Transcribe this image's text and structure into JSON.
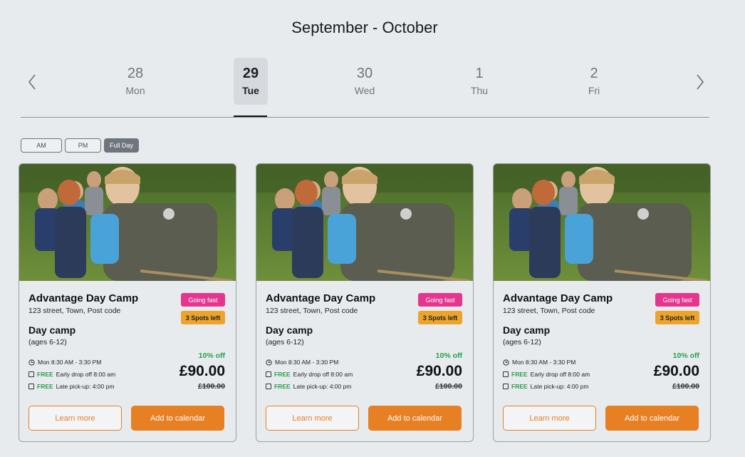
{
  "header": {
    "month_range": "September - October"
  },
  "dates": [
    {
      "num": "28",
      "day": "Mon"
    },
    {
      "num": "29",
      "day": "Tue"
    },
    {
      "num": "30",
      "day": "Wed"
    },
    {
      "num": "1",
      "day": "Thu"
    },
    {
      "num": "2",
      "day": "Fri"
    }
  ],
  "filters": {
    "am": "AM",
    "pm": "PM",
    "full_day": "Full Day"
  },
  "cards": [
    {
      "title": "Advantage Day Camp",
      "address": "123 street, Town, Post code",
      "badge_fast": "Going fast",
      "badge_spots": "3 Spots left",
      "type": "Day camp",
      "ages": "(ages 6-12)",
      "time": "Mon 8:30 AM - 3:30 PM",
      "free_label": "FREE",
      "drop_off": "Early drop off 8:00 am",
      "pick_up": "Late pick-up: 4:00 pm",
      "discount": "10% off",
      "price": "£90.00",
      "old_price": "£100.00",
      "learn_more": "Learn more",
      "add_to_calendar": "Add to calendar"
    },
    {
      "title": "Advantage Day Camp",
      "address": "123 street, Town, Post code",
      "badge_fast": "Going fast",
      "badge_spots": "3 Spots left",
      "type": "Day camp",
      "ages": "(ages 6-12)",
      "time": "Mon 8:30 AM - 3:30 PM",
      "free_label": "FREE",
      "drop_off": "Early drop off 8:00 am",
      "pick_up": "Late pick-up: 4:00 pm",
      "discount": "10% off",
      "price": "£90.00",
      "old_price": "£100.00",
      "learn_more": "Learn more",
      "add_to_calendar": "Add to calendar"
    },
    {
      "title": "Advantage Day Camp",
      "address": "123 street, Town, Post code",
      "badge_fast": "Going fast",
      "badge_spots": "3 Spots left",
      "type": "Day camp",
      "ages": "(ages 6-12)",
      "time": "Mon 8:30 AM - 3:30 PM",
      "free_label": "FREE",
      "drop_off": "Early drop off 8:00 am",
      "pick_up": "Late pick-up: 4:00 pm",
      "discount": "10% off",
      "price": "£90.00",
      "old_price": "£100.00",
      "learn_more": "Learn more",
      "add_to_calendar": "Add to calendar"
    }
  ],
  "colors": {
    "accent_orange": "#e77f23",
    "badge_pink": "#e5368f",
    "badge_yellow": "#eda42b",
    "discount_green": "#27a04a",
    "page_bg": "#e8ebee"
  }
}
